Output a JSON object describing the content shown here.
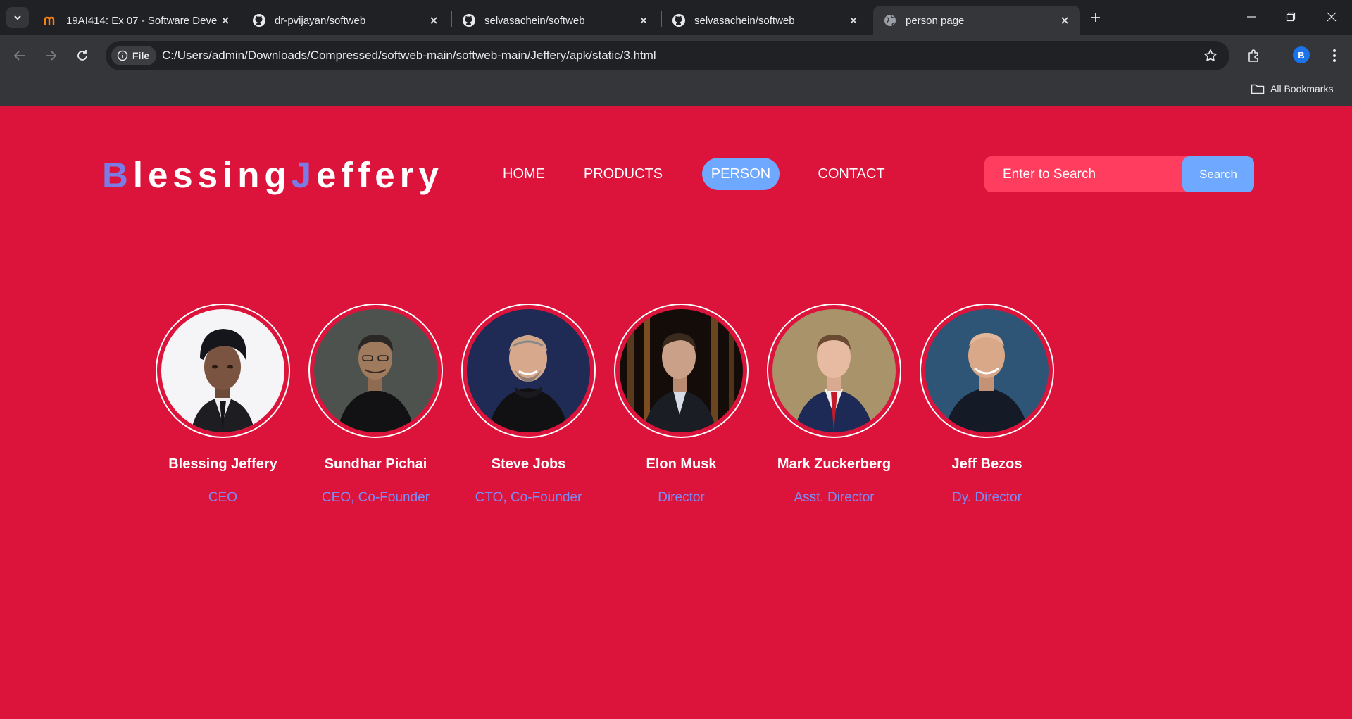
{
  "browser": {
    "tabs": [
      {
        "title": "19AI414: Ex 07 - Software Devel",
        "icon": "moodle-icon",
        "active": false
      },
      {
        "title": "dr-pvijayan/softweb",
        "icon": "github-icon",
        "active": false
      },
      {
        "title": "selvasachein/softweb",
        "icon": "github-icon",
        "active": false
      },
      {
        "title": "selvasachein/softweb",
        "icon": "github-icon",
        "active": false
      },
      {
        "title": "person page",
        "icon": "globe-icon",
        "active": true
      }
    ],
    "address": {
      "chip_label": "File",
      "url": "C:/Users/admin/Downloads/Compressed/softweb-main/softweb-main/Jeffery/apk/static/3.html"
    },
    "profile_initial": "B",
    "bookmarks": {
      "all_label": "All Bookmarks"
    }
  },
  "site": {
    "logo": {
      "b": "B",
      "part1": "lessing",
      "j": "J",
      "part2": "effery"
    },
    "nav": [
      {
        "label": "HOME",
        "active": false
      },
      {
        "label": "PRODUCTS",
        "active": false
      },
      {
        "label": "PERSON",
        "active": true
      },
      {
        "label": "CONTACT",
        "active": false
      }
    ],
    "search": {
      "placeholder": "Enter to Search",
      "button_label": "Search"
    },
    "colors": {
      "background": "#dc143c",
      "accent": "#6fa8ff",
      "logo_accent": "#7b7be6",
      "role_text": "#7d8bf5",
      "search_field": "#ff3d5f"
    },
    "people": [
      {
        "name": "Blessing Jeffery",
        "role": "CEO"
      },
      {
        "name": "Sundhar Pichai",
        "role": "CEO, Co-Founder"
      },
      {
        "name": "Steve Jobs",
        "role": "CTO, Co-Founder"
      },
      {
        "name": "Elon Musk",
        "role": "Director"
      },
      {
        "name": "Mark Zuckerberg",
        "role": "Asst. Director"
      },
      {
        "name": "Jeff Bezos",
        "role": "Dy. Director"
      }
    ]
  }
}
